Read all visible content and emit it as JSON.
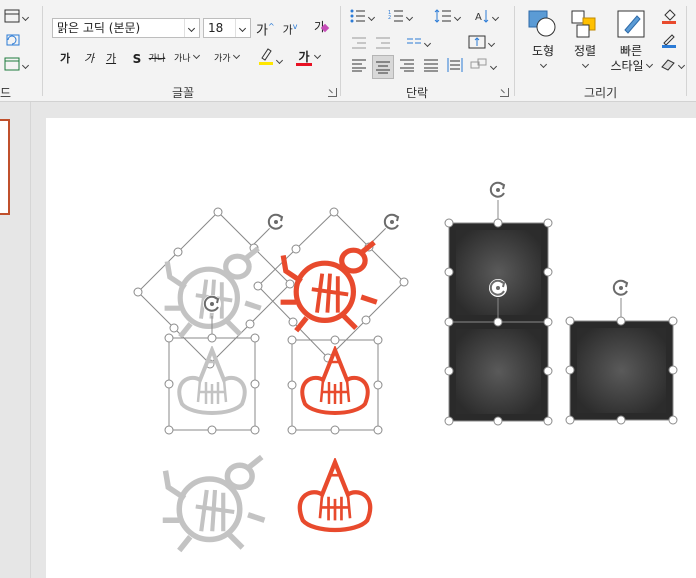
{
  "ribbon": {
    "font_group": {
      "font_name": "맑은 고딕 (본문)",
      "font_size": "18",
      "grow_label": "가",
      "shrink_label": "가",
      "clear_label": "가",
      "bold": "가",
      "italic": "가",
      "underline": "가",
      "shadow": "S",
      "strike": "가나",
      "spacing": "가나",
      "case": "가가",
      "font_color_label": "가",
      "group_label": "글꼴"
    },
    "paragraph_group": {
      "group_label": "단락"
    },
    "drawing_group": {
      "shapes_label": "도형",
      "arrange_label": "정렬",
      "quick_styles_line1": "빠른",
      "quick_styles_line2": "스타일",
      "group_label": "그리기"
    },
    "left_fragment_label": "드"
  },
  "colors": {
    "accent": "#e84a2d",
    "gray_icon": "#c3c3c3",
    "ribbon_bg": "#f3f3f3",
    "highlight_yellow": "#ffe600",
    "font_red": "#e81123",
    "dark_square": "#3a3a3a",
    "thumb_border": "#c0502c"
  },
  "icons": [
    "bug-icon",
    "witch-hat-icon",
    "rotate-handle-icon",
    "shapes-icon",
    "arrange-icon",
    "quick-styles-icon"
  ]
}
